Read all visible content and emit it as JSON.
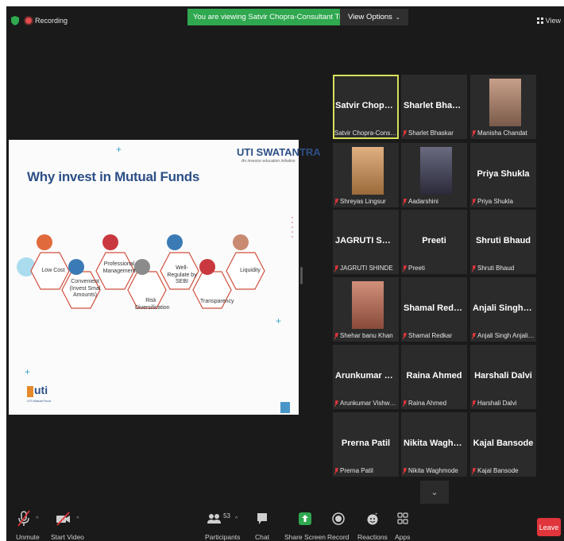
{
  "topbar": {
    "recording_label": "Recording",
    "viewing_banner": "You are viewing Satvir Chopra-Consultant Train...'s screen",
    "view_options_label": "View Options",
    "view_label": "View"
  },
  "slide": {
    "title": "Why invest in Mutual Funds",
    "brand": "UTI SWATANTRA",
    "brand_tagline": "An investor education initiative",
    "items": [
      "Low Cost",
      "Convenient (Invest Smal Amounts)",
      "Professional Management",
      "Risk Diversification",
      "Well-Regulate by SEBI",
      "Transparency",
      "Liquidity"
    ],
    "logo_text": "uti",
    "logo_sub": "UTI Mutual Fund"
  },
  "participants": [
    {
      "display": "Satvir  Chopra-C...",
      "label": "Satvir Chopra-Consultan...",
      "photo": false,
      "active": true,
      "muted": false
    },
    {
      "display": "Sharlet Bhaskar",
      "label": "Sharlet Bhaskar",
      "photo": false,
      "active": false,
      "muted": true
    },
    {
      "display": "",
      "label": "Manisha Chandat",
      "photo": true,
      "active": false,
      "muted": true
    },
    {
      "display": "",
      "label": "Shreyas Lingsur",
      "photo": true,
      "active": false,
      "muted": true
    },
    {
      "display": "",
      "label": "Aadarshini",
      "photo": true,
      "active": false,
      "muted": true
    },
    {
      "display": "Priya Shukla",
      "label": "Priya Shukla",
      "photo": false,
      "active": false,
      "muted": true
    },
    {
      "display": "JAGRUTI SHINDE",
      "label": "JAGRUTI SHINDE",
      "photo": false,
      "active": false,
      "muted": true
    },
    {
      "display": "Preeti",
      "label": "Preeti",
      "photo": false,
      "active": false,
      "muted": true
    },
    {
      "display": "Shruti Bhaud",
      "label": "Shruti Bhaud",
      "photo": false,
      "active": false,
      "muted": true
    },
    {
      "display": "",
      "label": "Shehar banu Khan",
      "photo": true,
      "active": false,
      "muted": true
    },
    {
      "display": "Shamal Redkar",
      "label": "Shamal Redkar",
      "photo": false,
      "active": false,
      "muted": true
    },
    {
      "display": "Anjali Singh Anj...",
      "label": "Anjali Singh Anjali Sin...",
      "photo": false,
      "active": false,
      "muted": true
    },
    {
      "display": "Arunkumar Vish...",
      "label": "Arunkumar Vishwakar...",
      "photo": false,
      "active": false,
      "muted": true
    },
    {
      "display": "Raina Ahmed",
      "label": "Raina Ahmed",
      "photo": false,
      "active": false,
      "muted": true
    },
    {
      "display": "Harshali Dalvi",
      "label": "Harshali Dalvi",
      "photo": false,
      "active": false,
      "muted": true
    },
    {
      "display": "Prerna Patil",
      "label": "Prerna Patil",
      "photo": false,
      "active": false,
      "muted": true
    },
    {
      "display": "Nikita Waghmode",
      "label": "Nikita Waghmode",
      "photo": false,
      "active": false,
      "muted": true
    },
    {
      "display": "Kajal Bansode",
      "label": "Kajal Bansode",
      "photo": false,
      "active": false,
      "muted": true
    }
  ],
  "toolbar": {
    "unmute": "Unmute",
    "start_video": "Start Video",
    "participants": "Participants",
    "participants_count": "53",
    "chat": "Chat",
    "share_screen": "Share Screen",
    "record": "Record",
    "reactions": "Reactions",
    "apps": "Apps",
    "leave": "Leave"
  },
  "colors": {
    "share_green": "#2fa84f",
    "leave_red": "#e0353b",
    "active_speaker": "#d9e05a",
    "slide_title_blue": "#2d4f86",
    "hex_outline": "#c0392b"
  }
}
